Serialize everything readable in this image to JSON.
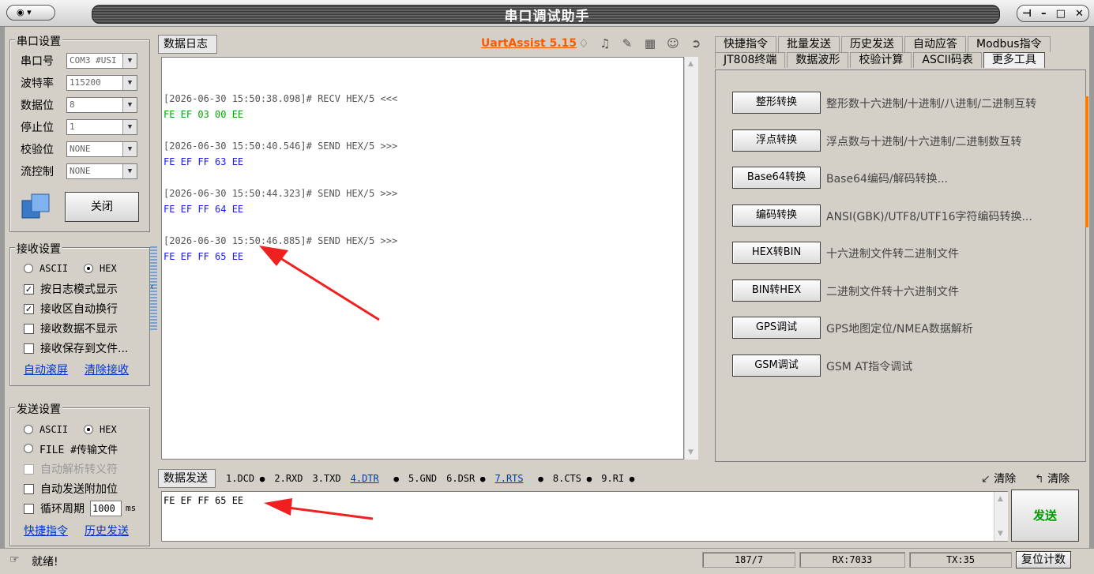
{
  "window": {
    "title": "串口调试助手",
    "sys_icon": "modem-icon"
  },
  "serial": {
    "group_title": "串口设置",
    "fields": [
      {
        "label": "串口号",
        "value": "COM3 #USI"
      },
      {
        "label": "波特率",
        "value": "115200"
      },
      {
        "label": "数据位",
        "value": "8"
      },
      {
        "label": "停止位",
        "value": "1"
      },
      {
        "label": "校验位",
        "value": "NONE"
      },
      {
        "label": "流控制",
        "value": "NONE"
      }
    ],
    "close_label": "关闭"
  },
  "recv": {
    "group_title": "接收设置",
    "ascii": "ASCII",
    "hex": "HEX",
    "mode": "HEX",
    "options": [
      {
        "label": "按日志模式显示",
        "checked": true
      },
      {
        "label": "接收区自动换行",
        "checked": true
      },
      {
        "label": "接收数据不显示",
        "checked": false
      },
      {
        "label": "接收保存到文件...",
        "checked": false
      }
    ],
    "links": [
      "自动滚屏",
      "清除接收"
    ]
  },
  "send_settings": {
    "group_title": "发送设置",
    "ascii": "ASCII",
    "hex": "HEX",
    "file": "FILE #传输文件",
    "auto_parse": "自动解析转义符",
    "append": "自动发送附加位",
    "cycle": "循环周期",
    "cycle_value": "1000",
    "cycle_unit": "ms",
    "links": [
      "快捷指令",
      "历史发送"
    ]
  },
  "log": {
    "tab": "数据日志",
    "brand": "UartAssist 5.15",
    "lines": [
      {
        "text": "",
        "color": "gray"
      },
      {
        "text": "[2026-06-30 15:50:38.098]# RECV HEX/5 <<<",
        "color": "gray"
      },
      {
        "text": "FE EF 03 00 EE",
        "color": "green"
      },
      {
        "text": "",
        "color": "gray"
      },
      {
        "text": "[2026-06-30 15:50:40.546]# SEND HEX/5 >>>",
        "color": "gray"
      },
      {
        "text": "FE EF FF 63 EE",
        "color": "blue"
      },
      {
        "text": "",
        "color": "gray"
      },
      {
        "text": "[2026-06-30 15:50:44.323]# SEND HEX/5 >>>",
        "color": "gray"
      },
      {
        "text": "FE EF FF 64 EE",
        "color": "blue"
      },
      {
        "text": "",
        "color": "gray"
      },
      {
        "text": "[2026-06-30 15:50:46.885]# SEND HEX/5 >>>",
        "color": "gray"
      },
      {
        "text": "FE EF FF 65 EE",
        "color": "blue"
      }
    ]
  },
  "tabs_row1": [
    "快捷指令",
    "批量发送",
    "历史发送",
    "自动应答",
    "Modbus指令"
  ],
  "tabs_row2": [
    "JT808终端",
    "数据波形",
    "校验计算",
    "ASCII码表",
    "更多工具"
  ],
  "tools": [
    {
      "button": "整形转换",
      "desc": "整形数十六进制/十进制/八进制/二进制互转"
    },
    {
      "button": "浮点转换",
      "desc": "浮点数与十进制/十六进制/二进制数互转"
    },
    {
      "button": "Base64转换",
      "desc": "Base64编码/解码转换..."
    },
    {
      "button": "编码转换",
      "desc": "ANSI(GBK)/UTF8/UTF16字符编码转换..."
    },
    {
      "button": "HEX转BIN",
      "desc": "十六进制文件转二进制文件"
    },
    {
      "button": "BIN转HEX",
      "desc": "二进制文件转十六进制文件"
    },
    {
      "button": "GPS调试",
      "desc": "GPS地图定位/NMEA数据解析"
    },
    {
      "button": "GSM调试",
      "desc": "GSM AT指令调试"
    }
  ],
  "send": {
    "tab": "数据发送",
    "signals": [
      {
        "label": "1.DCD",
        "dot": true,
        "link": false
      },
      {
        "label": "2.RXD",
        "dot": false,
        "link": false
      },
      {
        "label": "3.TXD",
        "dot": false,
        "link": false
      },
      {
        "label": "4.DTR",
        "dot": true,
        "link": true
      },
      {
        "label": "5.GND",
        "dot": false,
        "link": false
      },
      {
        "label": "6.DSR",
        "dot": true,
        "link": false
      },
      {
        "label": "7.RTS",
        "dot": true,
        "link": true
      },
      {
        "label": "8.CTS",
        "dot": true,
        "link": false
      },
      {
        "label": "9.RI",
        "dot": true,
        "link": false
      }
    ],
    "clear1": "清除",
    "clear2": "清除",
    "content": "FE EF FF 65 EE",
    "send_label": "发送"
  },
  "status": {
    "ready": "就绪!",
    "pos": "187/7",
    "rx": "RX:7033",
    "tx": "TX:35",
    "reset": "复位计数"
  }
}
